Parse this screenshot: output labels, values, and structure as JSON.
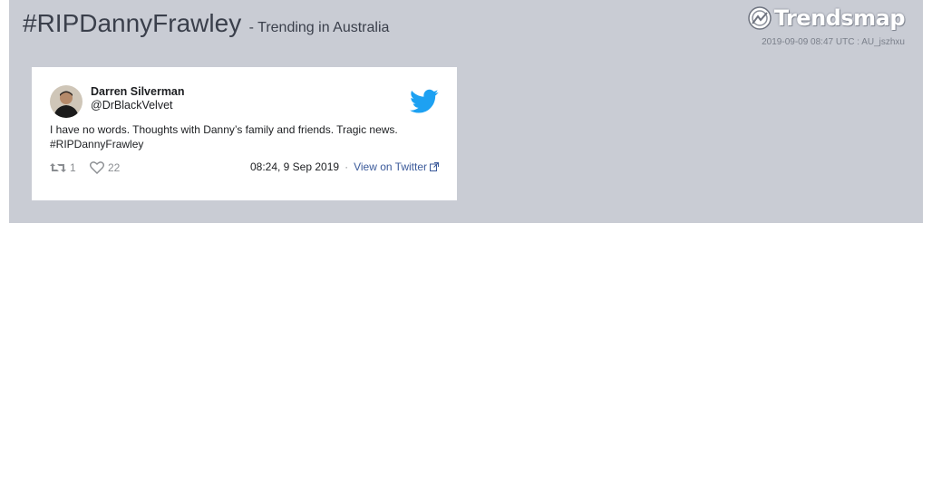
{
  "header": {
    "hashtag": "#RIPDannyFrawley",
    "subtitle": "- Trending in Australia",
    "brand": "Trendsmap",
    "meta": "2019-09-09 08:47 UTC : AU_jszhxu"
  },
  "tweet": {
    "author_name": "Darren Silverman",
    "author_handle": "@DrBlackVelvet",
    "text": "I have no words. Thoughts with Danny’s family and friends. Tragic news.",
    "hashtag": "#RIPDannyFrawley",
    "retweets": "1",
    "likes": "22",
    "timestamp": "08:24, 9 Sep 2019",
    "separator": "·",
    "view_label": "View on Twitter"
  },
  "colors": {
    "panel_bg": "#c9ccd4",
    "twitter_blue": "#1da1f2",
    "link": "#3b5a9a"
  },
  "icons": [
    "trendsmap-logo-icon",
    "twitter-bird-icon",
    "retweet-icon",
    "heart-icon",
    "external-link-icon"
  ]
}
